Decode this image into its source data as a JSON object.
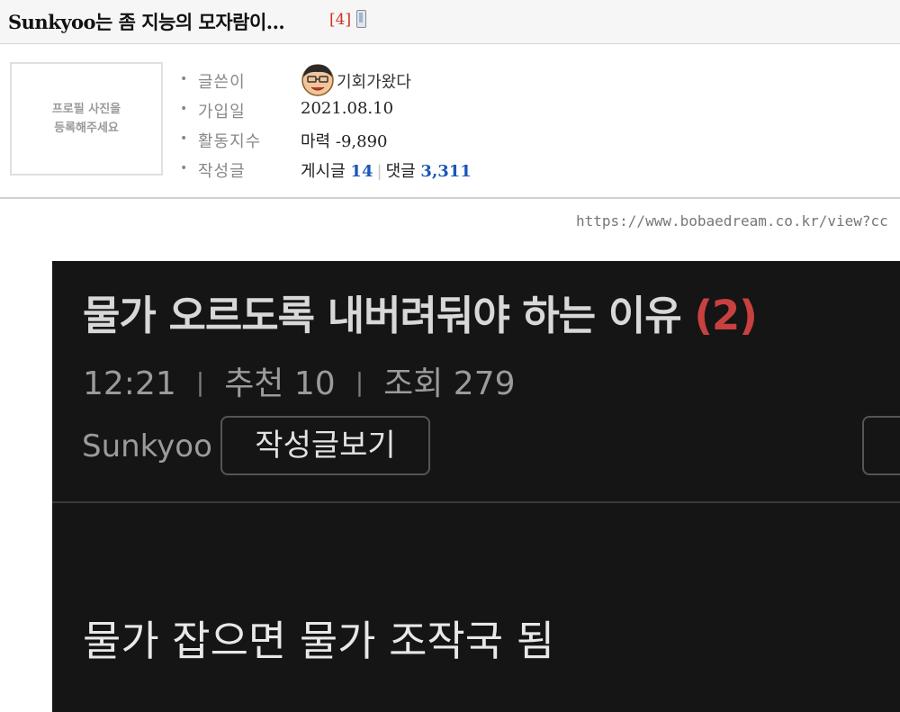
{
  "post": {
    "title": "Sunkyoo는 좀 지능의 모자람이...",
    "comment_count": "[4]",
    "mobile_icon": "mobile-phone-icon"
  },
  "profile": {
    "photo_placeholder": "프로필 사진을\n등록해주세요",
    "author_label": "글쓴이",
    "author_name": "기회가왔다",
    "joined_label": "가입일",
    "joined_value": "2021.08.10",
    "activity_label": "활동지수",
    "activity_prefix": "마력",
    "activity_value": "-9,890",
    "posts_label": "작성글",
    "posts_prefix": "게시글",
    "posts_count": "14",
    "comments_prefix": "댓글",
    "comments_count": "3,311"
  },
  "source_url": "https://www.bobaedream.co.kr/view?cc",
  "screenshot": {
    "title": "물가 오르도록 내버려둬야 하는 이유",
    "comment_count": "(2)",
    "time": "12:21",
    "recommend": "추천 10",
    "views": "조회 279",
    "author": "Sunkyoo",
    "posts_button": "작성글보기",
    "body": "물가 잡으면 물가 조작국 됨"
  },
  "colors": {
    "comment_count": "#d03020",
    "stat_blue": "#1a57b8",
    "screenshot_bg": "#151515",
    "screenshot_count": "#c94040"
  }
}
